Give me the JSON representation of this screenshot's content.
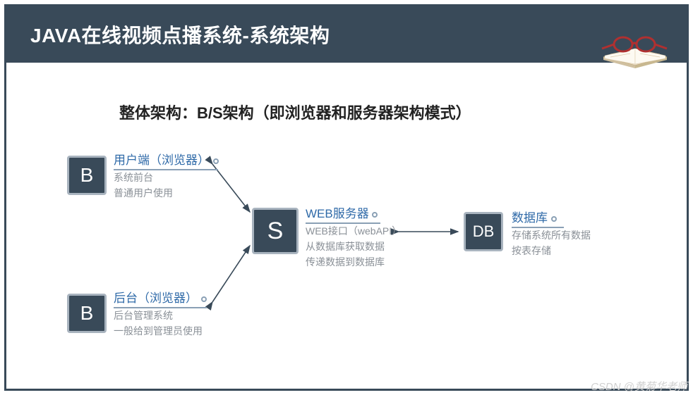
{
  "slide": {
    "title": "JAVA在线视频点播系统-系统架构",
    "headline": "整体架构：B/S架构（即浏览器和服务器架构模式）"
  },
  "nodes": {
    "client": {
      "box_label": "B",
      "title": "用户端（浏览器）",
      "desc1": "系统前台",
      "desc2": "普通用户使用"
    },
    "admin": {
      "box_label": "B",
      "title": "后台（浏览器）",
      "desc1": "后台管理系统",
      "desc2": "一般给到管理员使用"
    },
    "server": {
      "box_label": "S",
      "title": "WEB服务器",
      "desc1": "WEB接口（webAPI）",
      "desc2": "从数据库获取数据",
      "desc3": "传递数据到数据库"
    },
    "db": {
      "box_label": "DB",
      "title": "数据库",
      "desc1": "存储系统所有数据",
      "desc2": "按表存储"
    }
  },
  "watermark": "CSDN @黄菊华老师"
}
